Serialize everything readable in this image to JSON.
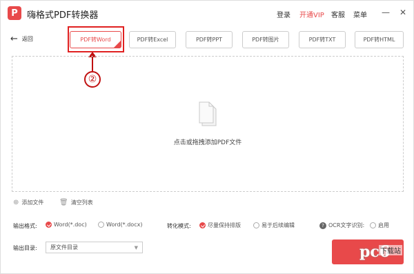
{
  "app": {
    "logo_glyph": "P",
    "title": "嗨格式PDF转换器"
  },
  "topbar": {
    "login": "登录",
    "vip": "开通VIP",
    "service": "客服",
    "menu": "菜单",
    "minimize": "—",
    "close": "✕"
  },
  "nav": {
    "back_label": "返回"
  },
  "tabs": [
    {
      "label": "PDF转Word",
      "active": true
    },
    {
      "label": "PDF转Excel"
    },
    {
      "label": "PDF转PPT"
    },
    {
      "label": "PDF转图片"
    },
    {
      "label": "PDF转TXT"
    },
    {
      "label": "PDF转HTML"
    }
  ],
  "annotation": {
    "number": "②",
    "color": "#e02020"
  },
  "dropzone": {
    "hint": "点击或拖拽添加PDF文件"
  },
  "file_actions": {
    "add": "添加文件",
    "clear": "清空列表"
  },
  "options": {
    "output_format_label": "输出格式:",
    "format_doc": "Word(*.doc)",
    "format_docx": "Word(*.docx)",
    "mode_label": "转化模式:",
    "mode_keep": "尽量保持排版",
    "mode_edit": "易于后续编辑",
    "ocr_label": "OCR文字识别:",
    "ocr_enable": "启用"
  },
  "output_dir": {
    "label": "输出目录:",
    "value": "原文件目录"
  },
  "watermark": {
    "main": "pc6",
    "sub": "下载站"
  },
  "colors": {
    "accent": "#e8494a"
  }
}
